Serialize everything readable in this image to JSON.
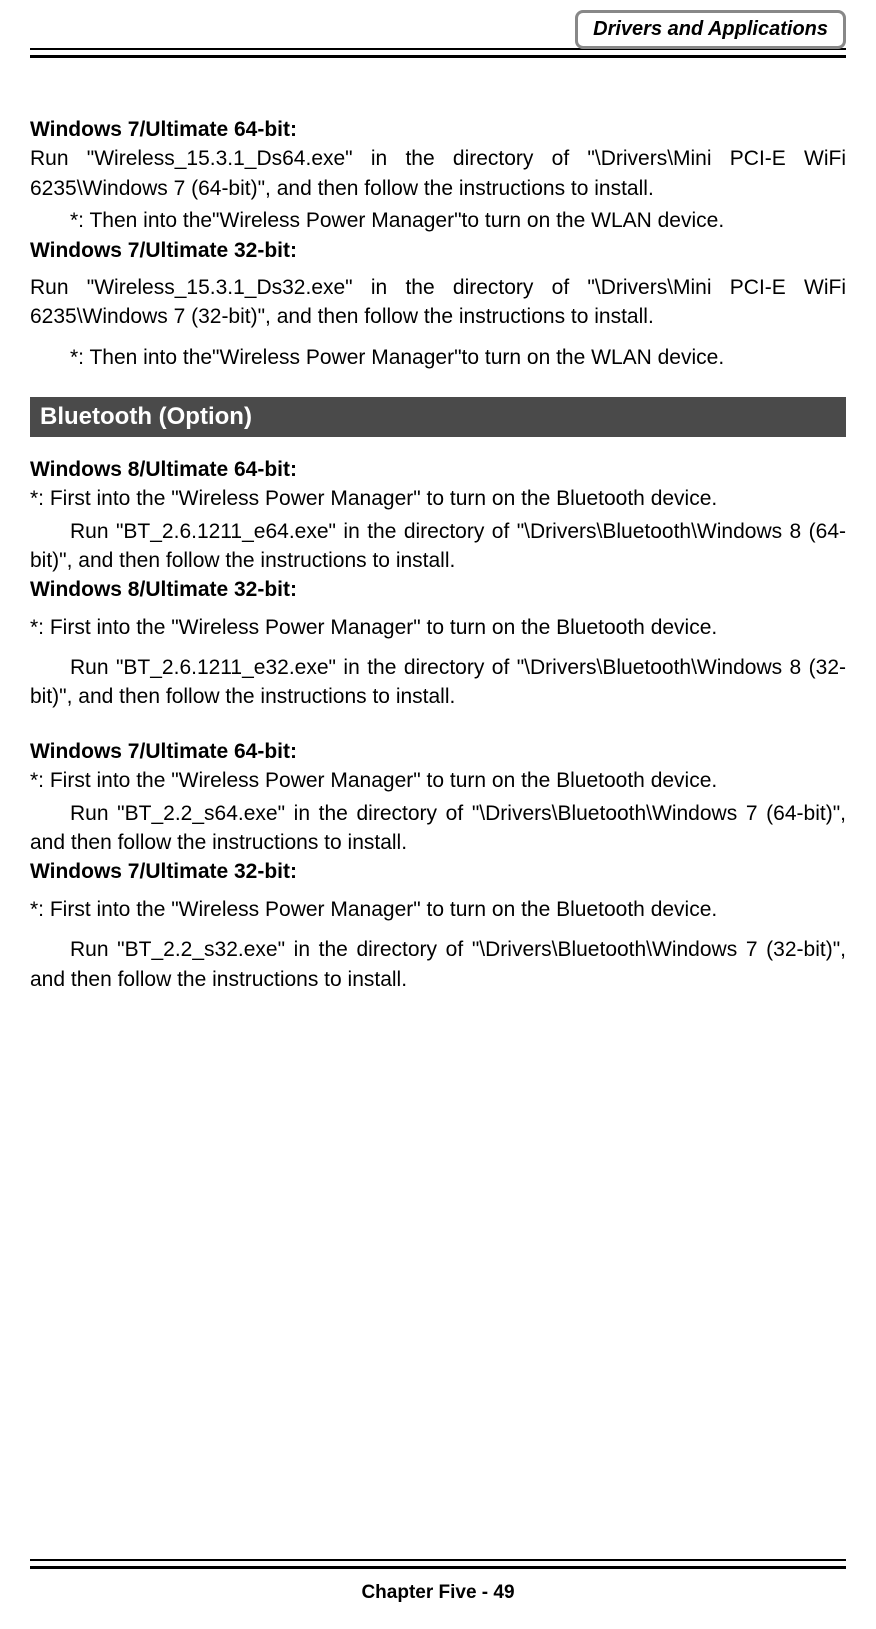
{
  "header": {
    "title": "Drivers and Applications"
  },
  "sections": {
    "win7_64": {
      "heading": "Windows 7/Ultimate 64-bit:",
      "body": "Run \"Wireless_15.3.1_Ds64.exe\" in the directory of \"\\Drivers\\Mini PCI-E WiFi 6235\\Windows 7 (64-bit)\", and then follow the instructions to install.",
      "note": "*: Then into the\"Wireless Power Manager\"to turn on the WLAN device."
    },
    "win7_32": {
      "heading": "Windows 7/Ultimate 32-bit:",
      "body": "Run \"Wireless_15.3.1_Ds32.exe\" in the directory of \"\\Drivers\\Mini PCI-E WiFi 6235\\Windows 7 (32-bit)\", and then follow the instructions to install.",
      "note": "*: Then into the\"Wireless Power Manager\"to turn on the WLAN device."
    },
    "bluetooth_header": "Bluetooth (Option)",
    "bt_win8_64": {
      "heading": "Windows 8/Ultimate 64-bit:",
      "note": "*: First into the \"Wireless Power Manager\" to turn on the Bluetooth device.",
      "body": "Run \"BT_2.6.1211_e64.exe\" in the directory of \"\\Drivers\\Bluetooth\\Windows 8 (64-bit)\", and then follow the instructions to install."
    },
    "bt_win8_32": {
      "heading": "Windows 8/Ultimate 32-bit:",
      "note": "*: First into the \"Wireless Power Manager\" to turn on the Bluetooth device.",
      "body": "Run \"BT_2.6.1211_e32.exe\" in the directory of \"\\Drivers\\Bluetooth\\Windows 8 (32-bit)\", and then follow the instructions to install."
    },
    "bt_win7_64": {
      "heading": "Windows 7/Ultimate 64-bit:",
      "note": "*: First into the \"Wireless Power Manager\" to turn on the Bluetooth device.",
      "body": "Run \"BT_2.2_s64.exe\" in the directory of \"\\Drivers\\Bluetooth\\Windows 7 (64-bit)\", and then follow the instructions to install."
    },
    "bt_win7_32": {
      "heading": "Windows 7/Ultimate 32-bit:",
      "note": "*: First into the \"Wireless Power Manager\" to turn on the Bluetooth device.",
      "body": "Run \"BT_2.2_s32.exe\" in the directory of \"\\Drivers\\Bluetooth\\Windows 7 (32-bit)\", and then follow the instructions to install."
    }
  },
  "footer": {
    "text": "Chapter Five - 49"
  }
}
